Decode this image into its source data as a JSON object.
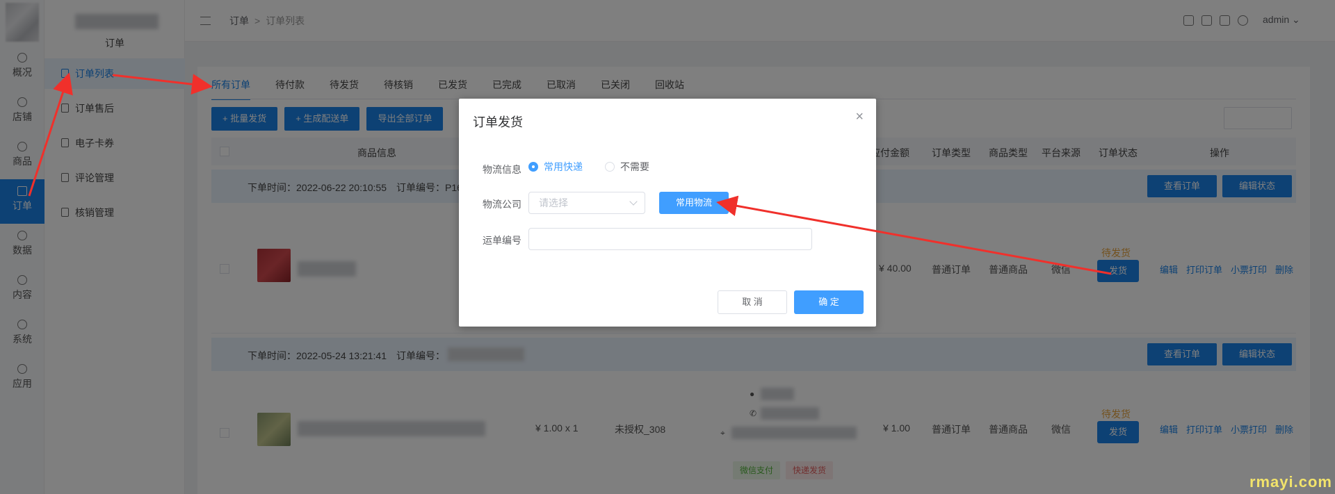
{
  "sidebar": {
    "items": [
      {
        "label": "概况",
        "icon": "dashboard-icon"
      },
      {
        "label": "店铺",
        "icon": "shop-icon"
      },
      {
        "label": "商品",
        "icon": "product-icon"
      },
      {
        "label": "订单",
        "icon": "order-icon",
        "active": true
      },
      {
        "label": "数据",
        "icon": "chart-icon"
      },
      {
        "label": "内容",
        "icon": "content-icon"
      },
      {
        "label": "系统",
        "icon": "gear-icon"
      },
      {
        "label": "应用",
        "icon": "app-icon"
      }
    ]
  },
  "subnav": {
    "title": "订单",
    "items": [
      {
        "label": "订单列表",
        "active": true
      },
      {
        "label": "订单售后"
      },
      {
        "label": "电子卡券"
      },
      {
        "label": "评论管理"
      },
      {
        "label": "核销管理"
      }
    ]
  },
  "topbar": {
    "breadcrumb": [
      "订单",
      ">",
      "订单列表"
    ],
    "user": "admin"
  },
  "tabs": [
    "所有订单",
    "待付款",
    "待发货",
    "待核销",
    "已发货",
    "已完成",
    "已取消",
    "已关闭",
    "回收站"
  ],
  "toolbar": {
    "batch_ship": "+ 批量发货",
    "gen_delivery": "+ 生成配送单",
    "export_all": "导出全部订单"
  },
  "table": {
    "headers": {
      "goods": "商品信息",
      "amount": "应付金额",
      "order_type": "订单类型",
      "goods_type": "商品类型",
      "source": "平台来源",
      "status": "订单状态",
      "ops": "操作"
    },
    "orders": [
      {
        "order_time": "下单时间：2022-06-22 20:10:55",
        "order_no": "订单编号：P16",
        "amount": "¥ 40.00",
        "order_type": "普通订单",
        "goods_type": "普通商品",
        "source": "微信",
        "status": "待发货",
        "ship_btn": "发货"
      },
      {
        "order_time": "下单时间：2022-05-24 13:21:41",
        "order_no": "订单编号：",
        "price_qty": "¥ 1.00 x 1",
        "buyer": "未授权_308",
        "pay_tag": "微信支付",
        "ship_tag": "快递发货",
        "amount": "¥ 1.00",
        "order_type": "普通订单",
        "goods_type": "普通商品",
        "source": "微信",
        "status": "待发货",
        "ship_btn": "发货"
      }
    ],
    "view_btn": "查看订单",
    "edit_status_btn": "编辑状态",
    "op_links": [
      "编辑",
      "打印订单",
      "小票打印",
      "删除"
    ]
  },
  "dialog": {
    "title": "订单发货",
    "close": "×",
    "logistics_label": "物流信息",
    "radio_express": "常用快递",
    "radio_none": "不需要",
    "company_label": "物流公司",
    "company_placeholder": "请选择",
    "common_btn": "常用物流",
    "waybill_label": "运单编号",
    "cancel": "取 消",
    "confirm": "确 定"
  },
  "watermark": "rmayi.com",
  "colors": {
    "primary": "#409eff",
    "sidebar_active": "#1a82e8",
    "warning": "#e6a23c",
    "annotation": "#f0302b"
  }
}
